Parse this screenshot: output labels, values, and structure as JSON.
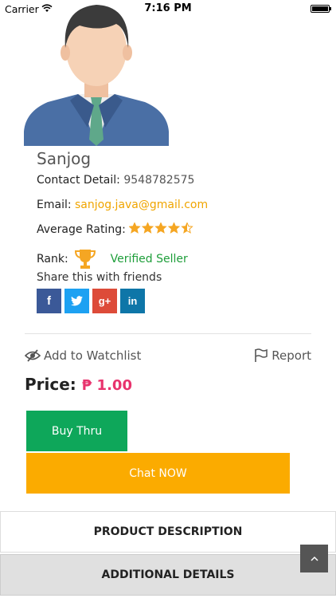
{
  "status_bar": {
    "carrier": "Carrier",
    "time": "7:16 PM"
  },
  "seller": {
    "name": "Sanjog",
    "contact_label": "Contact Detail:",
    "contact_value": "9548782575",
    "email_label": "Email:",
    "email_value": "sanjog.java@gmail.com",
    "rating_label": "Average Rating:",
    "rating_value": 4.5,
    "rating_max": 5,
    "rank_label": "Rank:",
    "rank_value": "Verified Seller",
    "share_label": "Share this with friends"
  },
  "social": [
    {
      "name": "facebook",
      "glyph": "f",
      "color": "#3b5998"
    },
    {
      "name": "twitter",
      "glyph": "t",
      "color": "#1da1f2"
    },
    {
      "name": "google-plus",
      "glyph": "g+",
      "color": "#dd4b39"
    },
    {
      "name": "linkedin",
      "glyph": "in",
      "color": "#0e76a8"
    }
  ],
  "actions": {
    "watchlist": "Add to Watchlist",
    "report": "Report"
  },
  "price": {
    "label": "Price:",
    "value": "₱ 1.00",
    "accent": "#e8336d"
  },
  "buttons": {
    "buy": "Buy Thru",
    "chat": "Chat NOW"
  },
  "tabs": {
    "description": "PRODUCT DESCRIPTION",
    "additional": "ADDITIONAL DETAILS"
  },
  "colors": {
    "buy": "#0ea75a",
    "chat": "#fbab00",
    "email": "#f0a500",
    "verified": "#1e9e3a",
    "stars": "#f5a623"
  }
}
